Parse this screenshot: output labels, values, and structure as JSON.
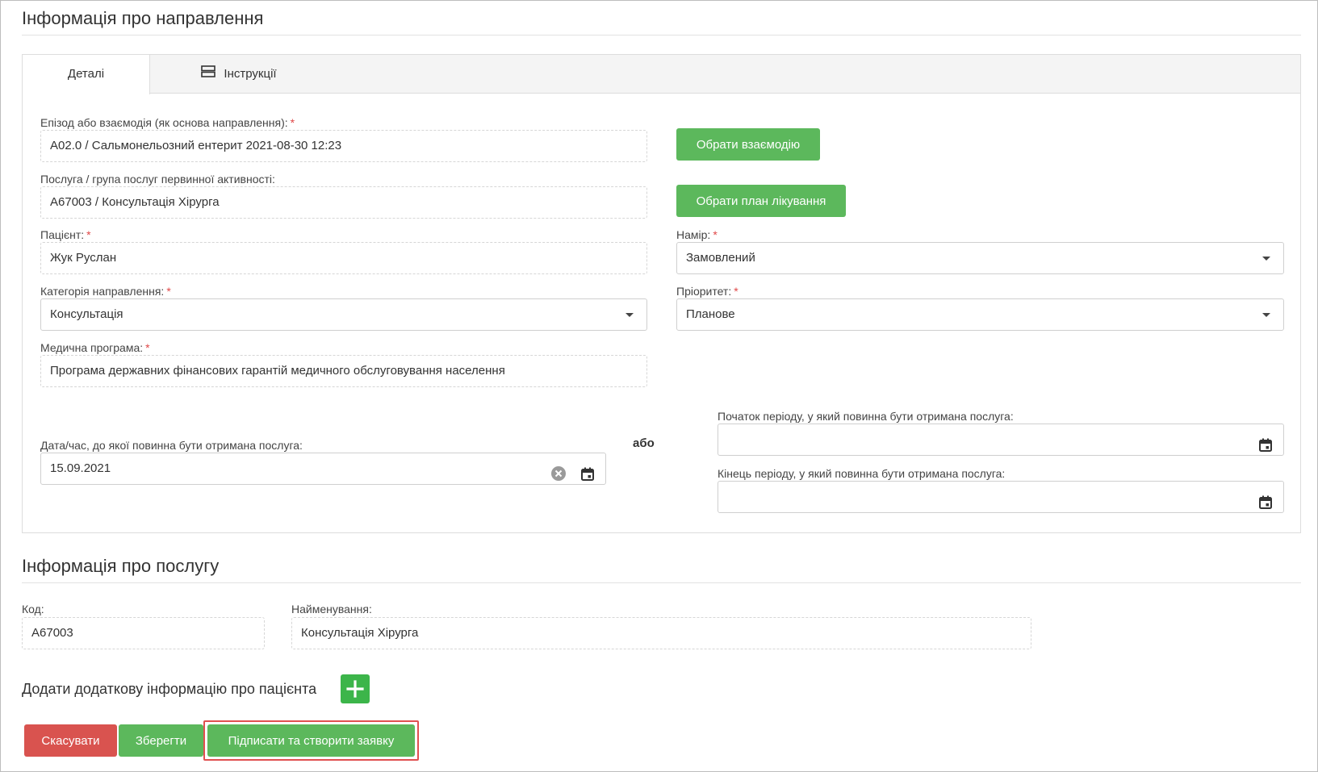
{
  "referral_section": {
    "title": "Інформація про направлення",
    "tabs": [
      {
        "label": "Деталі"
      },
      {
        "label": "Інструкції"
      }
    ]
  },
  "form": {
    "episode": {
      "label": "Епізод або взаємодія (як основа направлення):",
      "required": "*",
      "value": "A02.0 / Сальмонельозний ентерит 2021-08-30 12:23"
    },
    "service_group": {
      "label": "Послуга / група послуг первинної активності:",
      "value": "A67003 / Консультація Хірурга"
    },
    "patient": {
      "label": "Пацієнт:",
      "required": "*",
      "value": "Жук Руслан"
    },
    "category": {
      "label": "Категорія направлення:",
      "required": "*",
      "value": "Консультація"
    },
    "program": {
      "label": "Медична програма:",
      "required": "*",
      "value": "Програма державних фінансових гарантій медичного обслуговування населення"
    },
    "intent": {
      "label": "Намір:",
      "required": "*",
      "value": "Замовлений"
    },
    "priority": {
      "label": "Пріоритет:",
      "required": "*",
      "value": "Планове"
    },
    "due_date": {
      "label": "Дата/час, до якої повинна бути отримана послуга:",
      "value": "15.09.2021"
    },
    "or_label": "або",
    "period_start": {
      "label": "Початок періоду, у який повинна бути отримана послуга:",
      "value": ""
    },
    "period_end": {
      "label": "Кінець періоду, у який повинна бути отримана послуга:",
      "value": ""
    },
    "select_interaction_button": "Обрати взаємодію",
    "select_plan_button": "Обрати план лікування"
  },
  "service_section": {
    "title": "Інформація про послугу",
    "code": {
      "label": "Код:",
      "value": "A67003"
    },
    "name": {
      "label": "Найменування:",
      "value": "Консультація Хірурга"
    }
  },
  "additional_info": {
    "label": "Додати додаткову інформацію про пацієнта"
  },
  "actions": {
    "cancel": "Скасувати",
    "save": "Зберегти",
    "sign_create": "Підписати та створити заявку"
  },
  "colors": {
    "green": "#5cb85c",
    "red": "#d9534f",
    "required": "#e04848",
    "highlight": "#e05050"
  }
}
